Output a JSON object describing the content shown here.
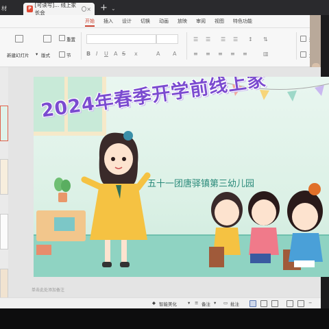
{
  "browser": {
    "partial_tab": "材",
    "active_tab_label": "[可读写]... 线上家长会",
    "new_tab": "+",
    "tab_menu": "⌄"
  },
  "menu": [
    "开始",
    "插入",
    "设计",
    "切换",
    "动画",
    "放映",
    "审阅",
    "视图",
    "特色功能"
  ],
  "ribbon": {
    "new_slide": "新建幻灯片",
    "layout": "版式",
    "reset": "重置",
    "section": "节",
    "shape": "形状",
    "textbox": "文本"
  },
  "slide": {
    "title": "2024年春季开学前线上家",
    "subtitle": "五十一团唐驿镇第三幼儿园"
  },
  "notes_hint": "单击此处添加备注",
  "status": {
    "beautify": "智能美化",
    "notes": "备注",
    "comments": "批注"
  },
  "colors": {
    "accent": "#c9412f",
    "title_purple": "#7b4bd0",
    "subtitle_teal": "#2a8a7a"
  }
}
